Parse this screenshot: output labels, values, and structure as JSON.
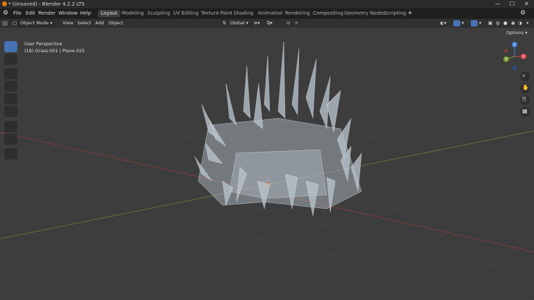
{
  "app": {
    "title": "* (Unsaved) - Blender 4.2.2 LTS",
    "blender_icon": "blender-logo-icon"
  },
  "menu": {
    "items": [
      "File",
      "Edit",
      "Render",
      "Window",
      "Help"
    ]
  },
  "workspaces": {
    "tabs": [
      "Layout",
      "Modeling",
      "Sculpting",
      "UV Editing",
      "Texture Paint",
      "Shading",
      "Animation",
      "Rendering",
      "Compositing",
      "Geometry Nodes",
      "Scripting"
    ],
    "active": "Layout",
    "add_icon": "+"
  },
  "header": {
    "mode": "Object Mode",
    "view": "View",
    "select": "Select",
    "add": "Add",
    "object": "Object",
    "transform_orientation": "Global",
    "options": "Options"
  },
  "viewport": {
    "perspective": "User Perspective",
    "selection": "(18) Grass.001 | Plane.025"
  },
  "gizmo": {
    "x": "X",
    "y": "Y",
    "z": "Z"
  },
  "colors": {
    "accent": "#4772b3",
    "x_axis": "#e04552",
    "y_axis": "#7ca332",
    "z_axis": "#3f82d9",
    "viewport_bg": "#3d3d3d",
    "grass": "#b9c3cc"
  },
  "toolbar": {
    "tools": [
      "select-box-icon",
      "cursor-icon",
      "move-icon",
      "rotate-icon",
      "scale-icon",
      "transform-icon",
      "annotate-icon",
      "measure-icon",
      "add-cube-icon"
    ]
  }
}
